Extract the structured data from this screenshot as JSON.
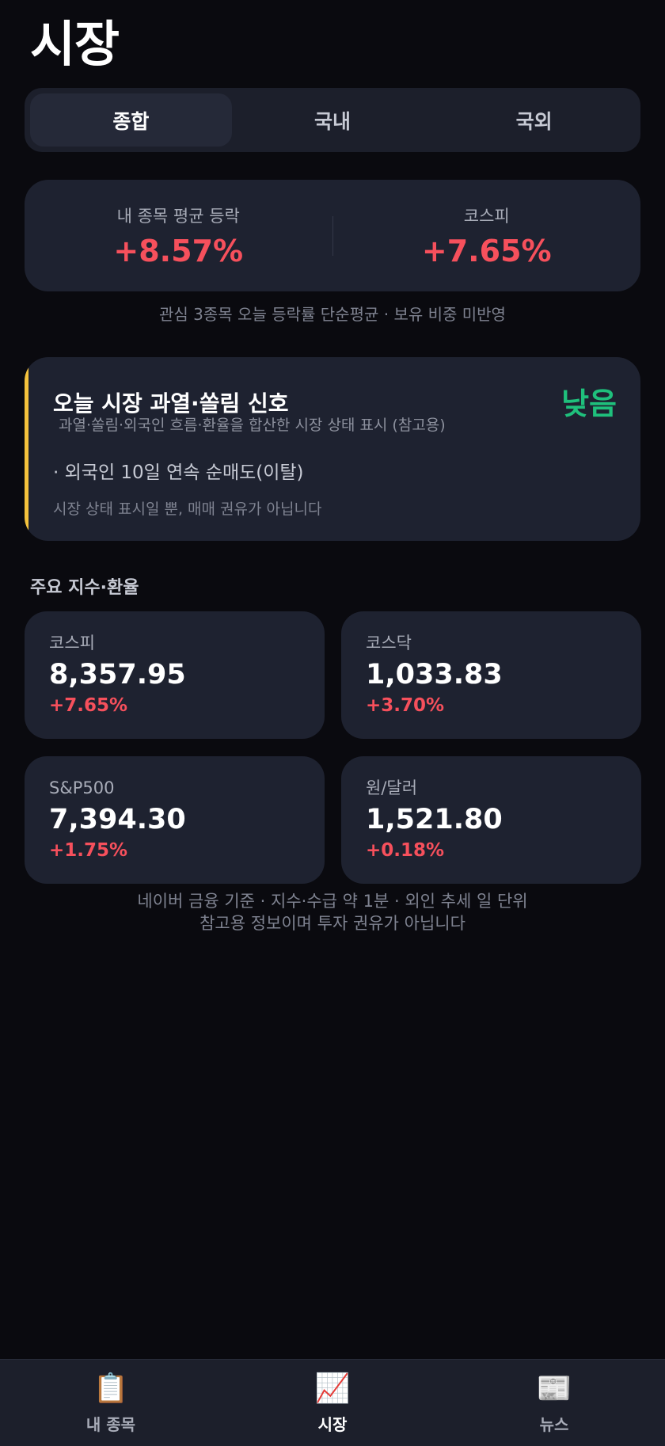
{
  "page": {
    "title": "시장"
  },
  "tabs": [
    {
      "label": "종합",
      "active": true
    },
    {
      "label": "국내",
      "active": false
    },
    {
      "label": "국외",
      "active": false
    }
  ],
  "summary": {
    "left_label": "내 종목 평균 등락",
    "left_value": "+8.57%",
    "right_label": "코스피",
    "right_value": "+7.65%",
    "caption": "관심 3종목 오늘 등락률 단순평균 · 보유 비중 미반영"
  },
  "signal": {
    "title": "오늘 시장 과열·쏠림 신호",
    "level": "낮음",
    "subtitle": "과열·쏠림·외국인 흐름·환율을 합산한 시장 상태 표시 (참고용)",
    "item": "· 외국인 10일 연속 순매도(이탈)",
    "note": "시장 상태 표시일 뿐, 매매 권유가 아닙니다"
  },
  "indices": {
    "section_title": "주요 지수·환율",
    "cards": [
      {
        "name": "코스피",
        "value": "8,357.95",
        "change": "+7.65%"
      },
      {
        "name": "코스닥",
        "value": "1,033.83",
        "change": "+3.70%"
      },
      {
        "name": "S&P500",
        "value": "7,394.30",
        "change": "+1.75%"
      },
      {
        "name": "원/달러",
        "value": "1,521.80",
        "change": "+0.18%"
      }
    ],
    "footer_line1": "네이버 금융 기준 · 지수·수급 약 1분 · 외인 추세 일 단위",
    "footer_line2": "참고용 정보이며 투자 권유가 아닙니다"
  },
  "nav": [
    {
      "label": "내 종목",
      "icon": "📋",
      "icon_name": "clipboard-icon"
    },
    {
      "label": "시장",
      "icon": "📈",
      "icon_name": "chart-up-icon",
      "active": true
    },
    {
      "label": "뉴스",
      "icon": "📰",
      "icon_name": "newspaper-icon"
    }
  ],
  "colors": {
    "up": "#f6505c",
    "low_signal": "#1fc07c",
    "accent": "#f4c23c",
    "card": "#1e2230",
    "background": "#0a0a0f"
  }
}
